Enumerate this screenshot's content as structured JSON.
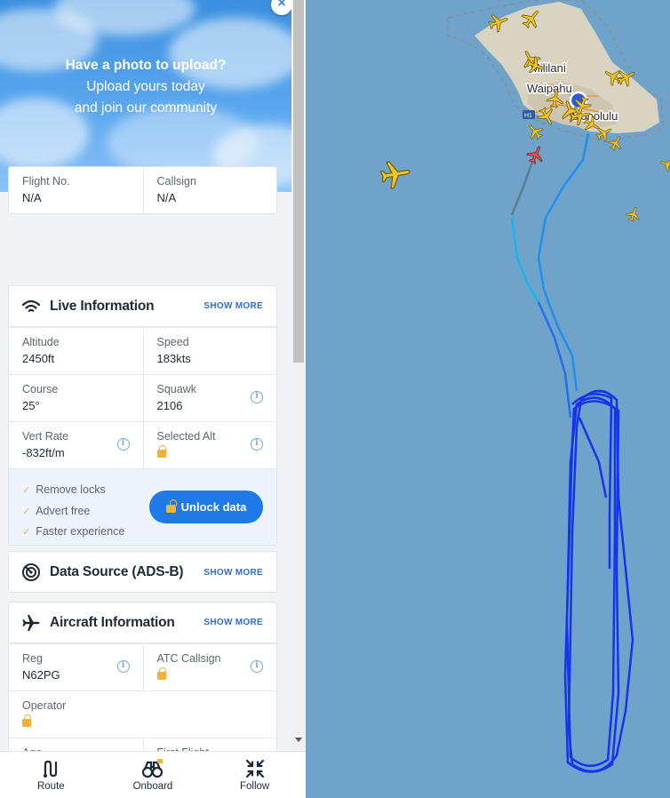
{
  "hero": {
    "title": "Have a photo to upload?",
    "line1": "Upload yours today",
    "line2": "and join our community",
    "close_glyph": "×"
  },
  "flight": {
    "flight_no_label": "Flight No.",
    "flight_no_value": "N/A",
    "callsign_label": "Callsign",
    "callsign_value": "N/A"
  },
  "live": {
    "title": "Live Information",
    "show_more": "SHOW MORE",
    "altitude_label": "Altitude",
    "altitude_value": "2450ft",
    "speed_label": "Speed",
    "speed_value": "183kts",
    "course_label": "Course",
    "course_value": "25°",
    "squawk_label": "Squawk",
    "squawk_value": "2106",
    "vert_rate_label": "Vert Rate",
    "vert_rate_value": "-832ft/m",
    "selected_alt_label": "Selected Alt",
    "perks": [
      "Remove locks",
      "Advert free",
      "Faster experience"
    ],
    "unlock_label": "Unlock data"
  },
  "data_source": {
    "title": "Data Source (ADS-B)",
    "show_more": "SHOW MORE"
  },
  "aircraft": {
    "title": "Aircraft Information",
    "show_more": "SHOW MORE",
    "reg_label": "Reg",
    "reg_value": "N62PG",
    "atc_callsign_label": "ATC Callsign",
    "operator_label": "Operator",
    "age_label": "Age",
    "first_flight_label": "First Flight"
  },
  "bottom_nav": {
    "route": "Route",
    "onboard": "Onboard",
    "follow": "Follow"
  },
  "map": {
    "labels": {
      "mililani": "Mililani",
      "waipahu": "Waipahu",
      "honolulu": "Honolulu",
      "highway": "H1"
    }
  },
  "colors": {
    "accent": "#1f79e6",
    "ocean": "#6fa3c9",
    "land": "#d9d3c2",
    "aircraft_yellow": "#f3c623",
    "selected_aircraft": "#d9534f",
    "lock": "#f2b233"
  }
}
